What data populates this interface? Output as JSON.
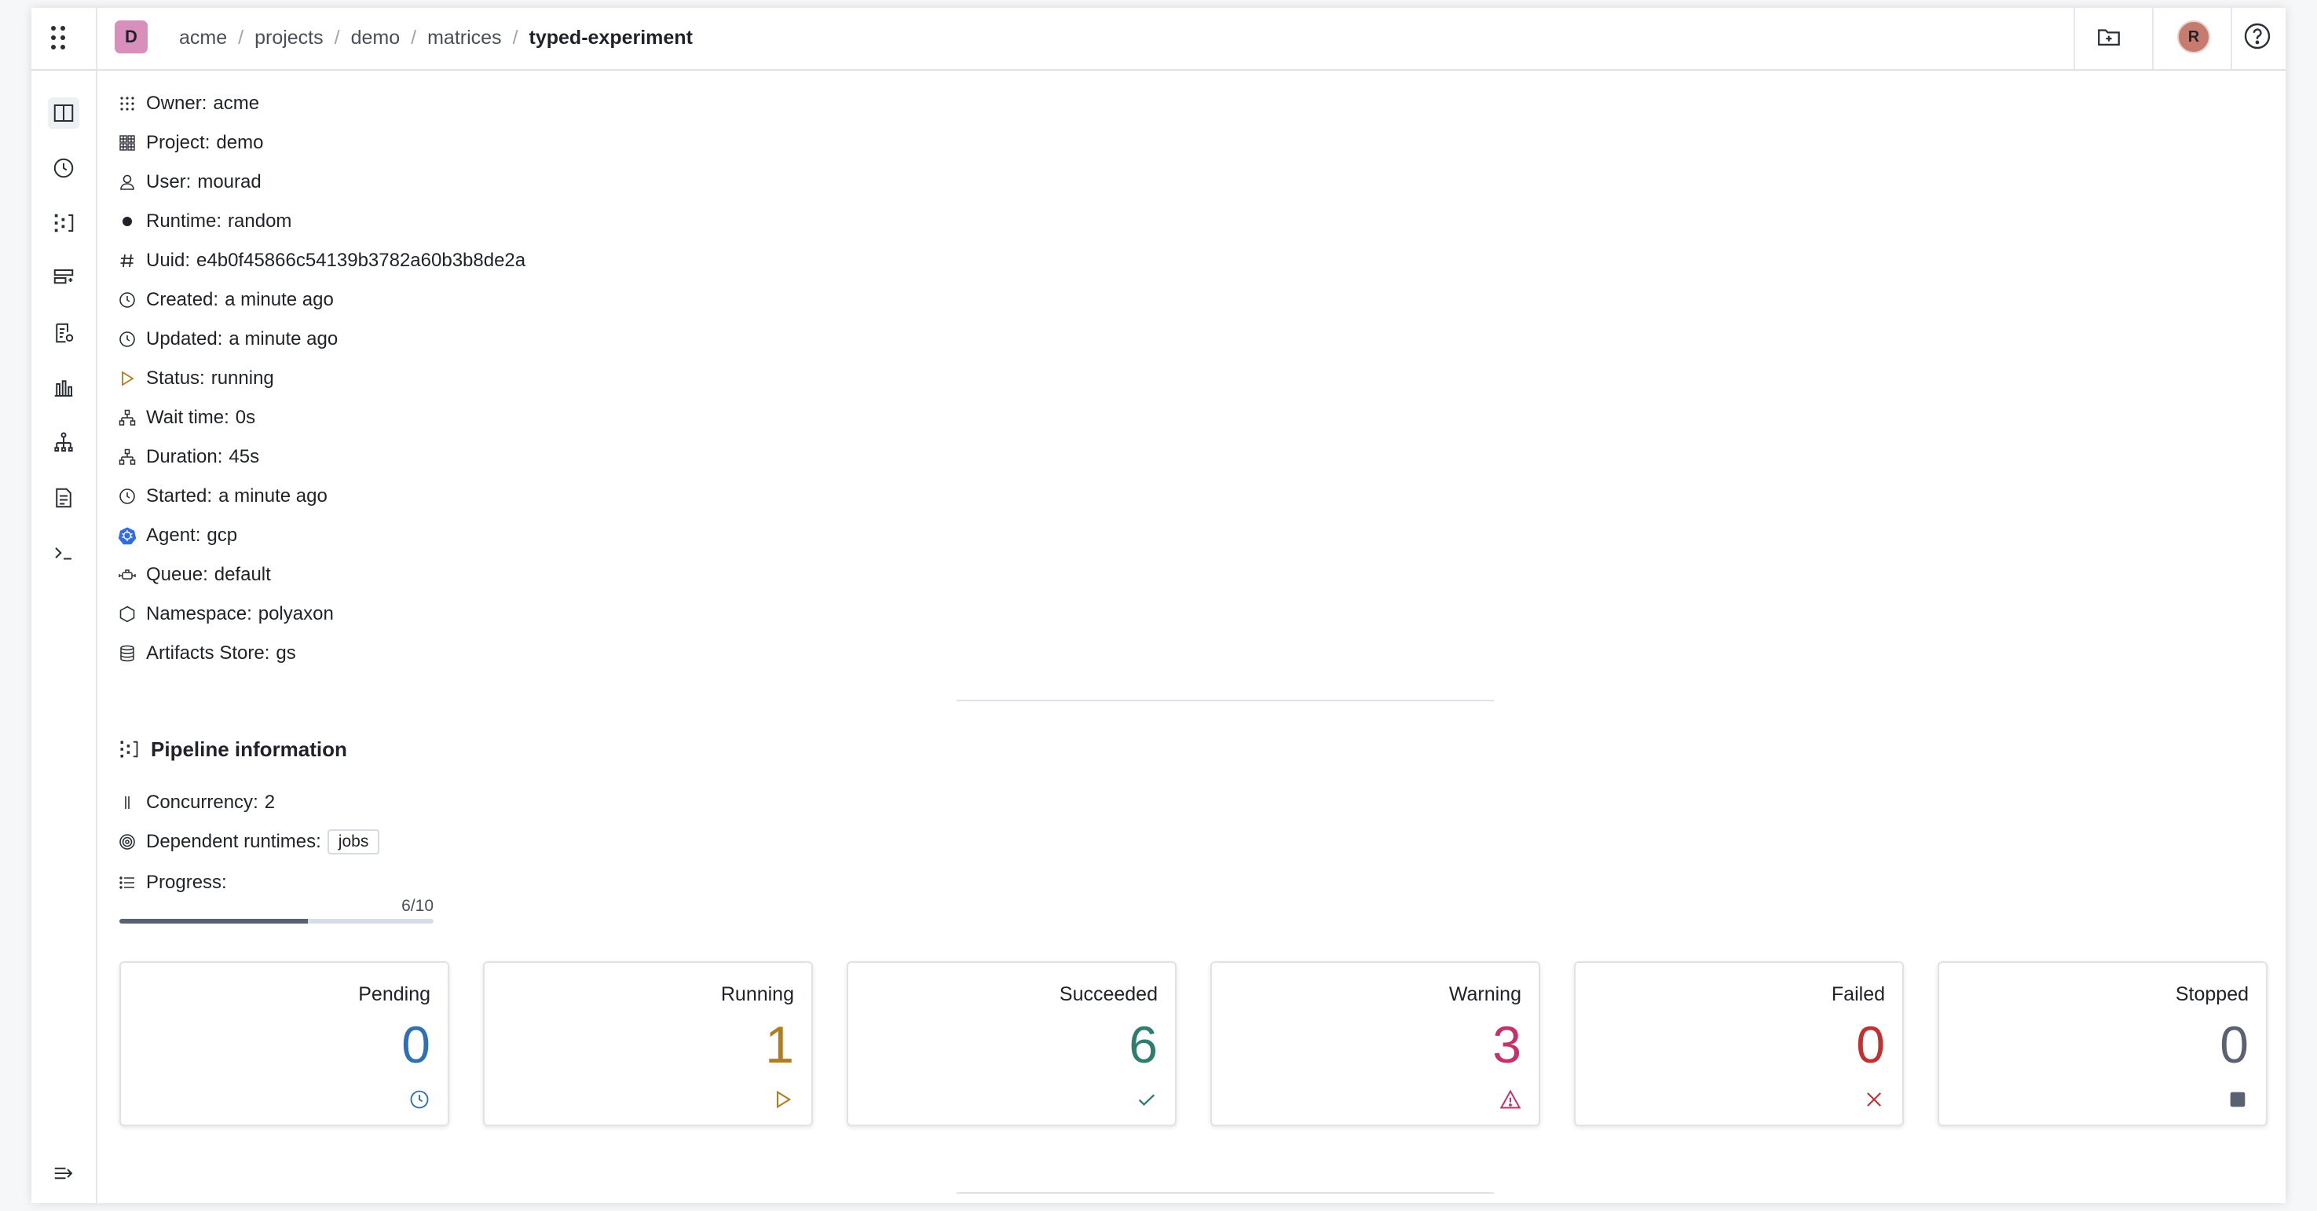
{
  "header": {
    "org_initial": "D",
    "breadcrumb": [
      "acme",
      "projects",
      "demo",
      "matrices"
    ],
    "current": "typed-experiment",
    "user_initial": "R"
  },
  "meta": [
    {
      "key": "owner",
      "icon": "grid-dots-icon",
      "label": "Owner",
      "value": "acme"
    },
    {
      "key": "project",
      "icon": "project-grid-icon",
      "label": "Project",
      "value": "demo"
    },
    {
      "key": "user",
      "icon": "user-icon",
      "label": "User",
      "value": "mourad"
    },
    {
      "key": "runtime",
      "icon": "dot-icon",
      "label": "Runtime",
      "value": "random"
    },
    {
      "key": "uuid",
      "icon": "hash-icon",
      "label": "Uuid",
      "value": "e4b0f45866c54139b3782a60b3b8de2a"
    },
    {
      "key": "created",
      "icon": "clock-icon",
      "label": "Created",
      "value": "a minute ago"
    },
    {
      "key": "updated",
      "icon": "clock-icon",
      "label": "Updated",
      "value": "a minute ago"
    },
    {
      "key": "status",
      "icon": "play-icon",
      "label": "Status",
      "value": "running"
    },
    {
      "key": "wait_time",
      "icon": "hierarchy-icon",
      "label": "Wait time",
      "value": "0s"
    },
    {
      "key": "duration",
      "icon": "hierarchy-icon",
      "label": "Duration",
      "value": "45s"
    },
    {
      "key": "started",
      "icon": "clock-icon",
      "label": "Started",
      "value": "a minute ago"
    },
    {
      "key": "agent",
      "icon": "kubernetes-icon",
      "label": "Agent",
      "value": "gcp"
    },
    {
      "key": "queue",
      "icon": "queue-icon",
      "label": "Queue",
      "value": "default"
    },
    {
      "key": "namespace",
      "icon": "hexagon-icon",
      "label": "Namespace",
      "value": "polyaxon"
    },
    {
      "key": "artifacts",
      "icon": "database-icon",
      "label": "Artifacts Store",
      "value": "gs"
    }
  ],
  "pipeline": {
    "title": "Pipeline information",
    "concurrency_label": "Concurrency",
    "concurrency_value": "2",
    "dependent_label": "Dependent runtimes:",
    "dependent_tag": "jobs",
    "progress_label": "Progress:",
    "progress_text": "6/10",
    "progress_fraction": 0.6
  },
  "stats": [
    {
      "key": "pending",
      "label": "Pending",
      "value": "0",
      "color": "#2f6fb3",
      "icon": "clock-icon"
    },
    {
      "key": "running",
      "label": "Running",
      "value": "1",
      "color": "#b07d1f",
      "icon": "play-icon"
    },
    {
      "key": "succeeded",
      "label": "Succeeded",
      "value": "6",
      "color": "#2e7d6f",
      "icon": "check-icon"
    },
    {
      "key": "warning",
      "label": "Warning",
      "value": "3",
      "color": "#c4326c",
      "icon": "warning-icon"
    },
    {
      "key": "failed",
      "label": "Failed",
      "value": "0",
      "color": "#c23030",
      "icon": "close-icon"
    },
    {
      "key": "stopped",
      "label": "Stopped",
      "value": "0",
      "color": "#5a6170",
      "icon": "stop-icon"
    }
  ]
}
